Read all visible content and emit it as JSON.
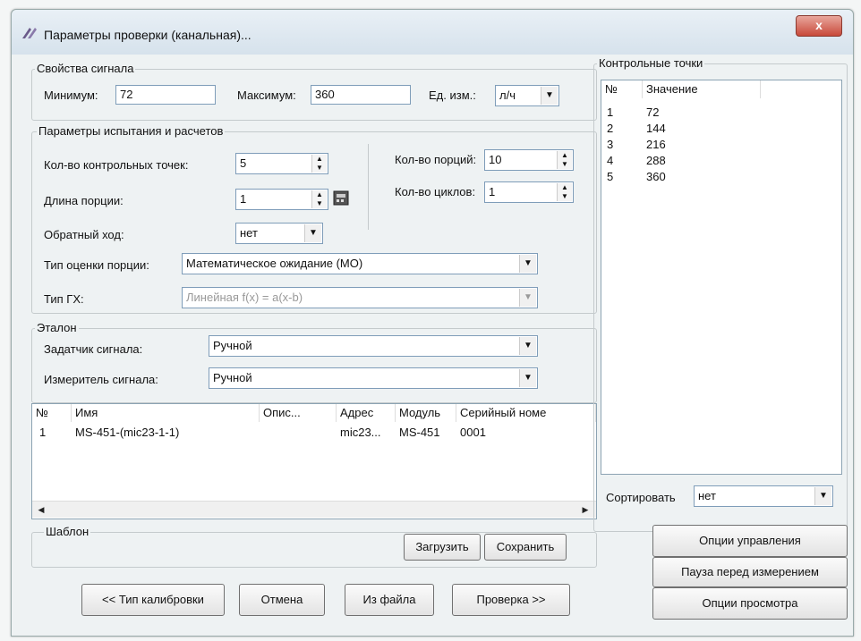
{
  "window": {
    "title": "Параметры проверки (канальная)...",
    "close_label": "x"
  },
  "signal_props": {
    "group_label": "Свойства сигнала",
    "min_label": "Минимум:",
    "min_value": "72",
    "max_label": "Максимум:",
    "max_value": "360",
    "unit_label": "Ед. изм.:",
    "unit_value": "л/ч"
  },
  "test_params": {
    "group_label": "Параметры испытания и расчетов",
    "points_label": "Кол-во контрольных точек:",
    "points_value": "5",
    "portion_len_label": "Длина порции:",
    "portion_len_value": "1",
    "reverse_label": "Обратный ход:",
    "reverse_value": "нет",
    "portions_label": "Кол-во порций:",
    "portions_value": "10",
    "cycles_label": "Кол-во циклов:",
    "cycles_value": "1",
    "eval_type_label": "Тип оценки порции:",
    "eval_type_value": "Математическое ожидание (МО)",
    "gx_type_label": "Тип ГХ:",
    "gx_type_value": "Линейная f(x) = a(x-b)"
  },
  "etalon": {
    "group_label": "Эталон",
    "setter_label": "Задатчик сигнала:",
    "setter_value": "Ручной",
    "meter_label": "Измеритель сигнала:",
    "meter_value": "Ручной"
  },
  "channels": {
    "columns": [
      "№",
      "Имя",
      "Опис...",
      "Адрес",
      "Модуль",
      "Серийный номе"
    ],
    "rows": [
      [
        "1",
        "MS-451-(mic23-1-1)",
        "",
        "mic23...",
        "MS-451",
        "0001"
      ]
    ]
  },
  "template": {
    "group_label": "Шаблон",
    "load_label": "Загрузить",
    "save_label": "Сохранить"
  },
  "control_points": {
    "group_label": "Контрольные точки",
    "columns": [
      "№",
      "Значение"
    ],
    "rows": [
      [
        "1",
        "72"
      ],
      [
        "2",
        "144"
      ],
      [
        "3",
        "216"
      ],
      [
        "4",
        "288"
      ],
      [
        "5",
        "360"
      ]
    ],
    "sort_label": "Сортировать",
    "sort_value": "нет"
  },
  "right_buttons": {
    "control_options": "Опции управления",
    "pause": "Пауза перед измерением",
    "view_options": "Опции просмотра"
  },
  "bottom_buttons": {
    "calib_type": "<< Тип калибровки",
    "cancel": "Отмена",
    "from_file": "Из файла",
    "check": "Проверка >>"
  }
}
